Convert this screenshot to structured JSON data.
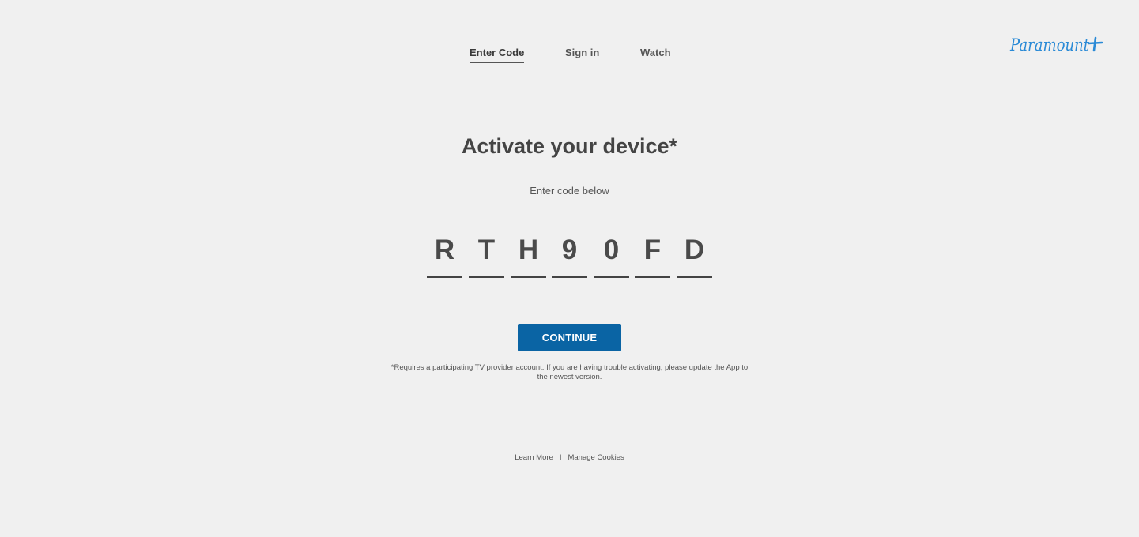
{
  "nav": {
    "items": [
      {
        "label": "Enter Code",
        "active": true
      },
      {
        "label": "Sign in",
        "active": false
      },
      {
        "label": "Watch",
        "active": false
      }
    ]
  },
  "brand": {
    "logo_text": "Paramount+",
    "logo_color": "#2a8ad6"
  },
  "main": {
    "title": "Activate your device*",
    "subtitle": "Enter code below",
    "code": [
      "R",
      "T",
      "H",
      "9",
      "0",
      "F",
      "D"
    ],
    "continue_label": "CONTINUE",
    "button_color": "#0a64a4",
    "disclaimer": "*Requires a participating TV provider account. If you are having trouble activating, please update the App to the newest version."
  },
  "footer": {
    "learn_more": "Learn More",
    "separator": "I",
    "manage_cookies": "Manage Cookies"
  }
}
